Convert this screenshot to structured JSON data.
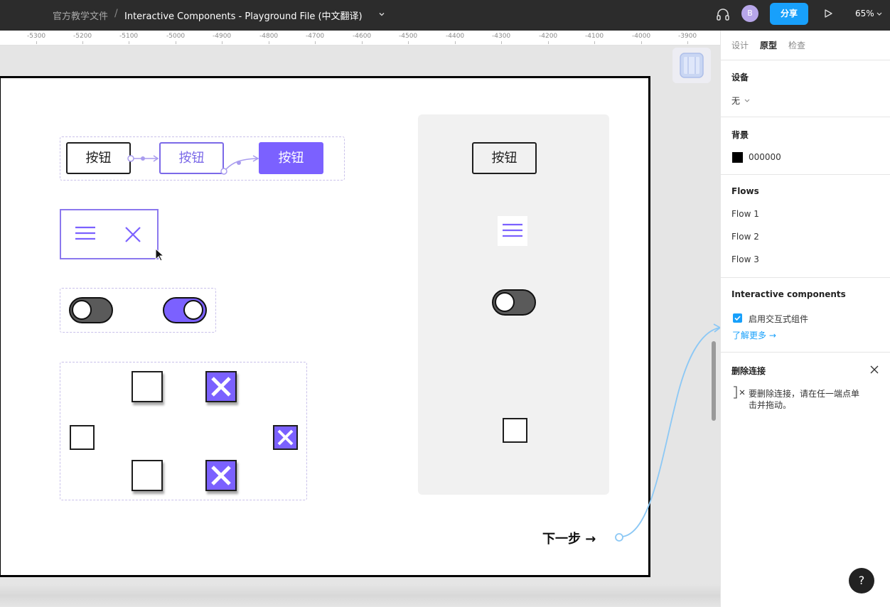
{
  "topbar": {
    "breadcrumb_parent": "官方教学文件",
    "separator": "/",
    "file_title": "Interactive Components - Playground File (中文翻译)",
    "avatar_initial": "B",
    "share_label": "分享",
    "zoom_label": "65%"
  },
  "ruler": {
    "ticks": [
      "-5300",
      "-5200",
      "-5100",
      "-5000",
      "-4900",
      "-4800",
      "-4700",
      "-4600",
      "-4500",
      "-4400",
      "-4300",
      "-4200",
      "-4100",
      "-4000",
      "-3900"
    ]
  },
  "canvas": {
    "button_label": "按钮",
    "preview_button_label": "按钮",
    "next_label": "下一步 →",
    "accent_color": "#7b61ff",
    "connector_color": "#8cc8f5"
  },
  "panel": {
    "tabs": [
      "设计",
      "原型",
      "检查"
    ],
    "active_tab": "原型",
    "device_title": "设备",
    "device_value": "无",
    "background_title": "背景",
    "background_value": "000000",
    "flows_title": "Flows",
    "flows": [
      "Flow 1",
      "Flow 2",
      "Flow 3"
    ],
    "interactive_title": "Interactive components",
    "interactive_checkbox_label": "启用交互式组件",
    "interactive_checked": true,
    "learn_more_label": "了解更多 →",
    "delete_title": "删除连接",
    "delete_hint_line1": "要删除连接，请在任一端点单",
    "delete_hint_line2": "击并拖动。",
    "help_label": "?"
  }
}
